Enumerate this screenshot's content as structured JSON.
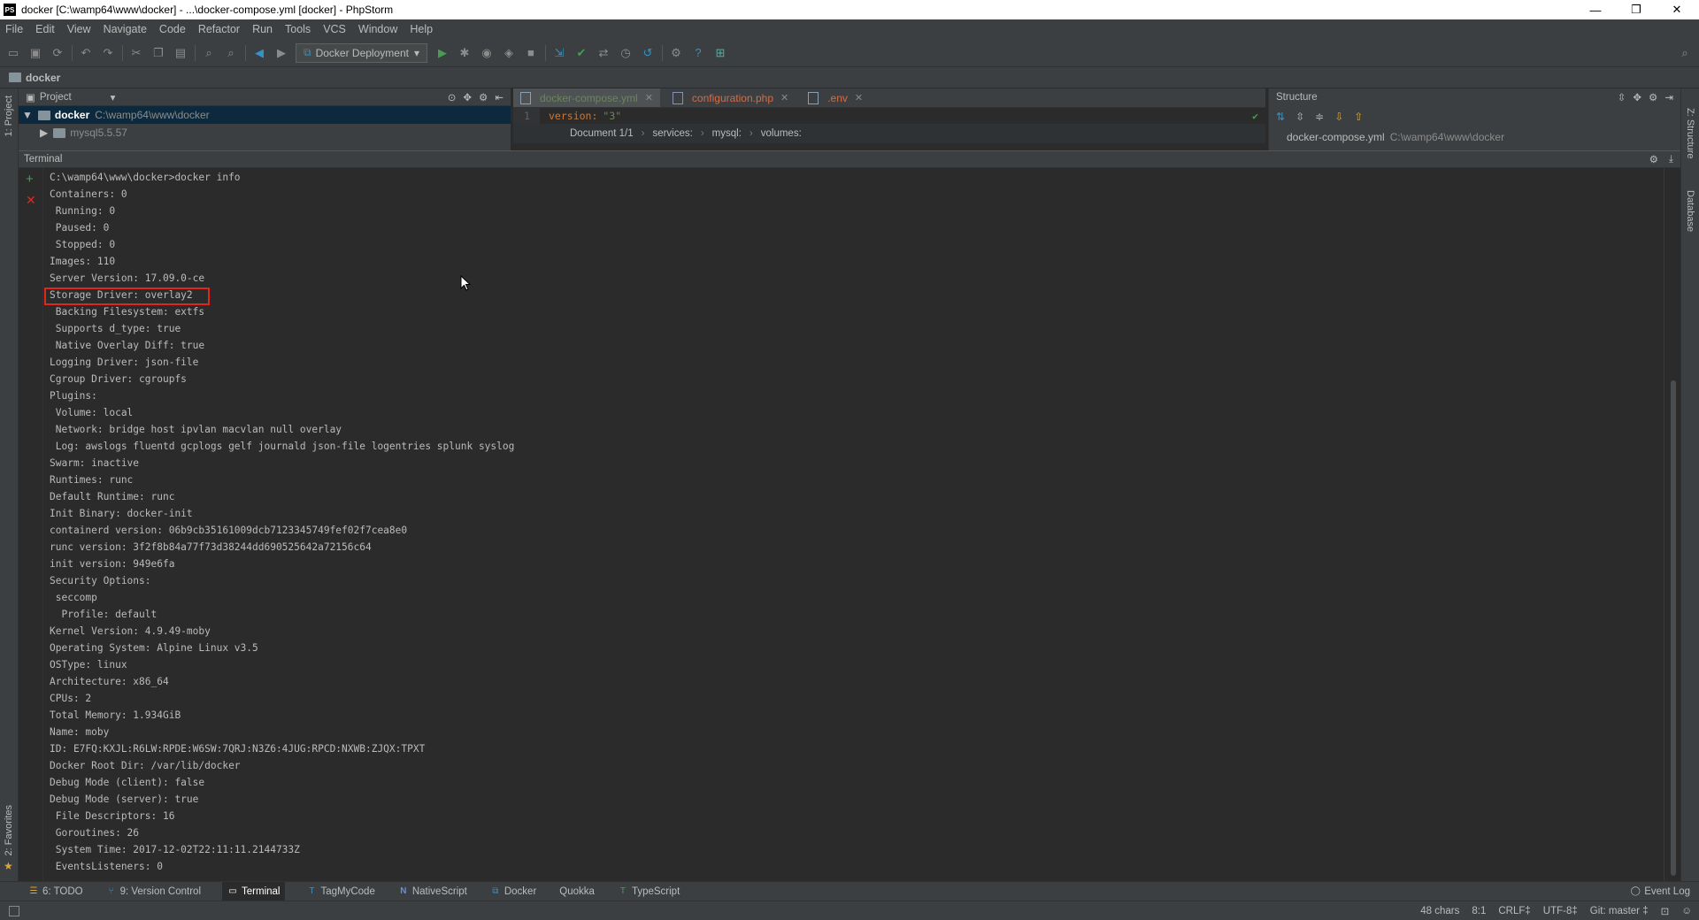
{
  "window": {
    "title": "docker [C:\\wamp64\\www\\docker] - ...\\docker-compose.yml [docker] - PhpStorm",
    "app_icon": "PS",
    "minimize": "—",
    "maximize": "❐",
    "close": "✕"
  },
  "menu": [
    "File",
    "Edit",
    "View",
    "Navigate",
    "Code",
    "Refactor",
    "Run",
    "Tools",
    "VCS",
    "Window",
    "Help"
  ],
  "toolbar": {
    "run_config": "Docker Deployment"
  },
  "navbar": {
    "project_name": "docker"
  },
  "left_strip": {
    "project_label": "1: Project",
    "favorites_label": "2: Favorites"
  },
  "right_strip": {
    "structure_label": "Z: Structure",
    "database_label": "Database"
  },
  "project_panel": {
    "header": "Project",
    "root_name": "docker",
    "root_path": "C:\\wamp64\\www\\docker",
    "child_name": "mysql5.5.57"
  },
  "editor": {
    "tabs": [
      {
        "label": "docker-compose.yml",
        "icon": "yml-file-icon",
        "active": true
      },
      {
        "label": "configuration.php",
        "icon": "php-file-icon",
        "active": false
      },
      {
        "label": ".env",
        "icon": "env-file-icon",
        "active": false
      }
    ],
    "line_number": "1",
    "code_key": "version:",
    "code_value": "\"3\"",
    "breadcrumbs": [
      "Document 1/1",
      "services:",
      "mysql:",
      "volumes:"
    ]
  },
  "structure_panel": {
    "header": "Structure",
    "file_name": "docker-compose.yml",
    "file_path": "C:\\wamp64\\www\\docker"
  },
  "terminal": {
    "header": "Terminal",
    "lines": [
      "C:\\wamp64\\www\\docker>docker info",
      "Containers: 0",
      " Running: 0",
      " Paused: 0",
      " Stopped: 0",
      "Images: 110",
      "Server Version: 17.09.0-ce",
      "Storage Driver: overlay2",
      " Backing Filesystem: extfs",
      " Supports d_type: true",
      " Native Overlay Diff: true",
      "Logging Driver: json-file",
      "Cgroup Driver: cgroupfs",
      "Plugins:",
      " Volume: local",
      " Network: bridge host ipvlan macvlan null overlay",
      " Log: awslogs fluentd gcplogs gelf journald json-file logentries splunk syslog",
      "Swarm: inactive",
      "Runtimes: runc",
      "Default Runtime: runc",
      "Init Binary: docker-init",
      "containerd version: 06b9cb35161009dcb7123345749fef02f7cea8e0",
      "runc version: 3f2f8b84a77f73d38244dd690525642a72156c64",
      "init version: 949e6fa",
      "Security Options:",
      " seccomp",
      "  Profile: default",
      "Kernel Version: 4.9.49-moby",
      "Operating System: Alpine Linux v3.5",
      "OSType: linux",
      "Architecture: x86_64",
      "CPUs: 2",
      "Total Memory: 1.934GiB",
      "Name: moby",
      "ID: E7FQ:KXJL:R6LW:RPDE:W6SW:7QRJ:N3Z6:4JUG:RPCD:NXWB:ZJQX:TPXT",
      "Docker Root Dir: /var/lib/docker",
      "Debug Mode (client): false",
      "Debug Mode (server): true",
      " File Descriptors: 16",
      " Goroutines: 26",
      " System Time: 2017-12-02T22:11:11.2144733Z",
      " EventsListeners: 0"
    ]
  },
  "bottom_tools": [
    {
      "label": "6: TODO",
      "icon": "todo-icon",
      "active": false
    },
    {
      "label": "9: Version Control",
      "icon": "version-control-icon",
      "active": false
    },
    {
      "label": "Terminal",
      "icon": "terminal-icon",
      "active": true
    },
    {
      "label": "TagMyCode",
      "icon": "tagmycode-icon",
      "active": false
    },
    {
      "label": "NativeScript",
      "icon": "nativescript-icon",
      "active": false
    },
    {
      "label": "Docker",
      "icon": "docker-icon",
      "active": false
    },
    {
      "label": "Quokka",
      "icon": "",
      "active": false
    },
    {
      "label": "TypeScript",
      "icon": "typescript-icon",
      "active": false
    }
  ],
  "event_log": "Event Log",
  "status": {
    "chars": "48 chars",
    "position": "8:1",
    "line_sep": "CRLF‡",
    "encoding": "UTF-8‡",
    "git": "Git: master ‡"
  },
  "colors": {
    "highlight": "#e0271e",
    "accent_green": "#499c54",
    "accent_blue": "#3592c4"
  }
}
